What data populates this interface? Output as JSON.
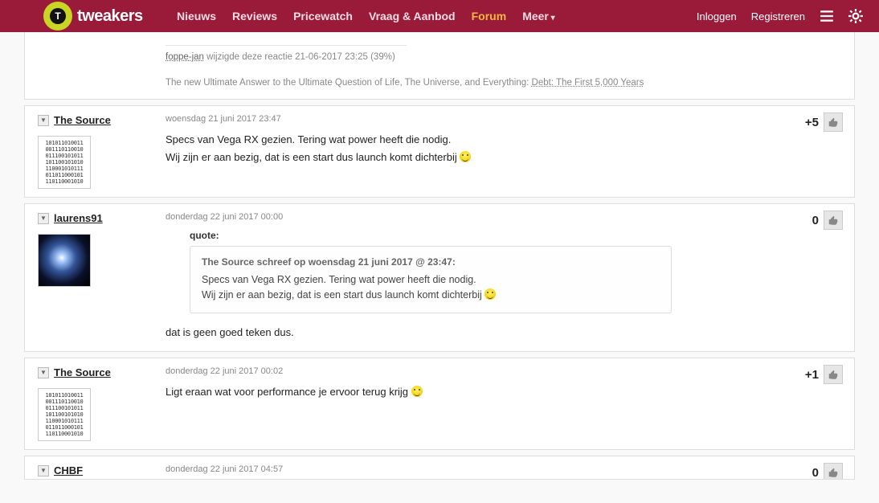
{
  "brand": "tweakers",
  "nav": {
    "items": [
      "Nieuws",
      "Reviews",
      "Pricewatch",
      "Vraag & Aanbod",
      "Forum",
      "Meer"
    ],
    "active_index": 4
  },
  "account": {
    "login": "Inloggen",
    "register": "Registreren"
  },
  "prev_fragment": {
    "edit_by_label": "foppe-jan",
    "edit_text": " wijzigde deze reactie 21-06-2017 23:25 (39%)",
    "sig_text": "The new Ultimate Answer to the Ultimate Question of Life, The Universe, and Everything: ",
    "sig_link": "Debt: The First 5,000 Years"
  },
  "posts": [
    {
      "user": "The Source",
      "avatar": "binary",
      "timestamp": "woensdag 21 juni 2017 23:47",
      "score": "+5",
      "lines": [
        "Specs van Vega RX gezien. Tering wat power heeft die nodig.",
        "Wij zijn er aan bezig, dat is een start dus launch komt dichterbij"
      ],
      "smile_after_line": 1
    },
    {
      "user": "laurens91",
      "avatar": "galaxy",
      "timestamp": "donderdag 22 juni 2017 00:00",
      "score": "0",
      "quote": {
        "label": "quote:",
        "head": "The Source schreef op woensdag 21 juni 2017 @ 23:47:",
        "lines": [
          "Specs van Vega RX gezien. Tering wat power heeft die nodig.",
          "Wij zijn er aan bezig, dat is een start dus launch komt dichterbij"
        ],
        "smile_after_line": 1
      },
      "reply": "dat is geen goed teken dus."
    },
    {
      "user": "The Source",
      "avatar": "binary",
      "timestamp": "donderdag 22 juni 2017 00:02",
      "score": "+1",
      "lines": [
        "Ligt eraan wat voor performance je ervoor terug krijg"
      ],
      "smile_after_line": 0
    },
    {
      "user": "CHBF",
      "timestamp": "donderdag 22 juni 2017 04:57",
      "score": "0"
    }
  ],
  "binary_avatar_text": "101011010011\n001110110010\n011100101011\n101100101010\n110001010111\n011011000101\n110110001010"
}
